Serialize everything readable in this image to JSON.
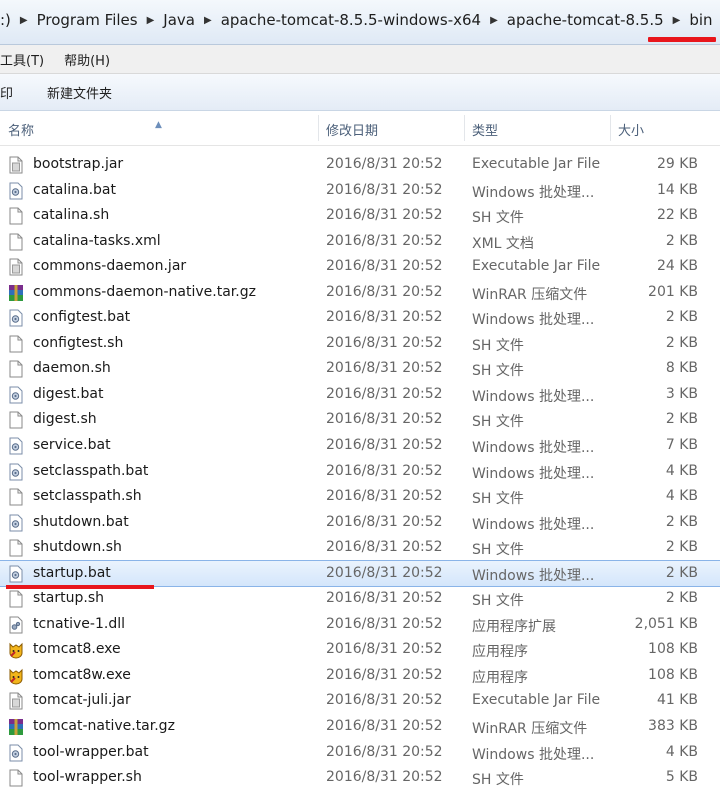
{
  "address": {
    "prefix": ":)",
    "crumbs": [
      "Program Files",
      "Java",
      "apache-tomcat-8.5.5-windows-x64",
      "apache-tomcat-8.5.5",
      "bin"
    ]
  },
  "menu": {
    "tools": "工具(T)",
    "help": "帮助(H)"
  },
  "toolbar": {
    "partial": "印",
    "new_folder": "新建文件夹"
  },
  "columns": {
    "name": "名称",
    "date": "修改日期",
    "type": "类型",
    "size": "大小"
  },
  "colors": {
    "selection": "#d4e6fb",
    "annotation": "#e8161c"
  },
  "files": [
    {
      "name": "bootstrap.jar",
      "date": "2016/8/31 20:52",
      "type": "Executable Jar File",
      "size": "29 KB",
      "icon": "jar-icon"
    },
    {
      "name": "catalina.bat",
      "date": "2016/8/31 20:52",
      "type": "Windows 批处理...",
      "size": "14 KB",
      "icon": "bat-icon"
    },
    {
      "name": "catalina.sh",
      "date": "2016/8/31 20:52",
      "type": "SH 文件",
      "size": "22 KB",
      "icon": "file-icon"
    },
    {
      "name": "catalina-tasks.xml",
      "date": "2016/8/31 20:52",
      "type": "XML 文档",
      "size": "2 KB",
      "icon": "file-icon"
    },
    {
      "name": "commons-daemon.jar",
      "date": "2016/8/31 20:52",
      "type": "Executable Jar File",
      "size": "24 KB",
      "icon": "jar-icon"
    },
    {
      "name": "commons-daemon-native.tar.gz",
      "date": "2016/8/31 20:52",
      "type": "WinRAR 压缩文件",
      "size": "201 KB",
      "icon": "winrar-icon"
    },
    {
      "name": "configtest.bat",
      "date": "2016/8/31 20:52",
      "type": "Windows 批处理...",
      "size": "2 KB",
      "icon": "bat-icon"
    },
    {
      "name": "configtest.sh",
      "date": "2016/8/31 20:52",
      "type": "SH 文件",
      "size": "2 KB",
      "icon": "file-icon"
    },
    {
      "name": "daemon.sh",
      "date": "2016/8/31 20:52",
      "type": "SH 文件",
      "size": "8 KB",
      "icon": "file-icon"
    },
    {
      "name": "digest.bat",
      "date": "2016/8/31 20:52",
      "type": "Windows 批处理...",
      "size": "3 KB",
      "icon": "bat-icon"
    },
    {
      "name": "digest.sh",
      "date": "2016/8/31 20:52",
      "type": "SH 文件",
      "size": "2 KB",
      "icon": "file-icon"
    },
    {
      "name": "service.bat",
      "date": "2016/8/31 20:52",
      "type": "Windows 批处理...",
      "size": "7 KB",
      "icon": "bat-icon"
    },
    {
      "name": "setclasspath.bat",
      "date": "2016/8/31 20:52",
      "type": "Windows 批处理...",
      "size": "4 KB",
      "icon": "bat-icon"
    },
    {
      "name": "setclasspath.sh",
      "date": "2016/8/31 20:52",
      "type": "SH 文件",
      "size": "4 KB",
      "icon": "file-icon"
    },
    {
      "name": "shutdown.bat",
      "date": "2016/8/31 20:52",
      "type": "Windows 批处理...",
      "size": "2 KB",
      "icon": "bat-icon"
    },
    {
      "name": "shutdown.sh",
      "date": "2016/8/31 20:52",
      "type": "SH 文件",
      "size": "2 KB",
      "icon": "file-icon"
    },
    {
      "name": "startup.bat",
      "date": "2016/8/31 20:52",
      "type": "Windows 批处理...",
      "size": "2 KB",
      "icon": "bat-icon",
      "selected": true
    },
    {
      "name": "startup.sh",
      "date": "2016/8/31 20:52",
      "type": "SH 文件",
      "size": "2 KB",
      "icon": "file-icon"
    },
    {
      "name": "tcnative-1.dll",
      "date": "2016/8/31 20:52",
      "type": "应用程序扩展",
      "size": "2,051 KB",
      "icon": "dll-icon"
    },
    {
      "name": "tomcat8.exe",
      "date": "2016/8/31 20:52",
      "type": "应用程序",
      "size": "108 KB",
      "icon": "tomcat-icon"
    },
    {
      "name": "tomcat8w.exe",
      "date": "2016/8/31 20:52",
      "type": "应用程序",
      "size": "108 KB",
      "icon": "tomcat-icon"
    },
    {
      "name": "tomcat-juli.jar",
      "date": "2016/8/31 20:52",
      "type": "Executable Jar File",
      "size": "41 KB",
      "icon": "jar-icon"
    },
    {
      "name": "tomcat-native.tar.gz",
      "date": "2016/8/31 20:52",
      "type": "WinRAR 压缩文件",
      "size": "383 KB",
      "icon": "winrar-icon"
    },
    {
      "name": "tool-wrapper.bat",
      "date": "2016/8/31 20:52",
      "type": "Windows 批处理...",
      "size": "4 KB",
      "icon": "bat-icon"
    },
    {
      "name": "tool-wrapper.sh",
      "date": "2016/8/31 20:52",
      "type": "SH 文件",
      "size": "5 KB",
      "icon": "file-icon"
    }
  ]
}
